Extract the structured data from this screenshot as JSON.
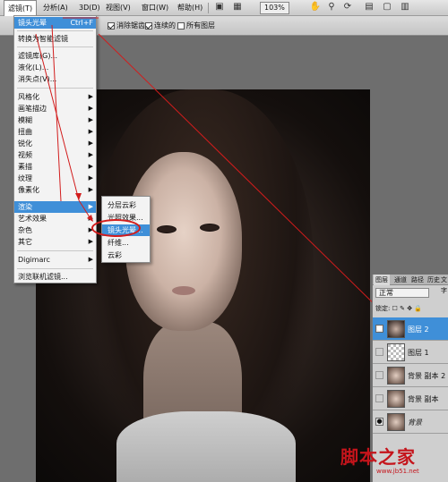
{
  "menubar": {
    "items": [
      "滤镜(T)",
      "分析(A)",
      "3D(D)",
      "视图(V)",
      "窗口(W)",
      "帮助(H)"
    ],
    "zoom": "103%"
  },
  "options": {
    "antialias": "消除锯齿",
    "contiguous": "连续的",
    "all_layers": "所有图层"
  },
  "filter_menu": {
    "items": [
      {
        "label": "镜头光晕",
        "shortcut": "Ctrl+F"
      },
      {
        "label": "转换为智能滤镜"
      },
      {
        "label": "滤镜库(G)..."
      },
      {
        "label": "液化(L)..."
      },
      {
        "label": "消失点(V)..."
      },
      {
        "label": "风格化"
      },
      {
        "label": "画笔描边"
      },
      {
        "label": "模糊"
      },
      {
        "label": "扭曲"
      },
      {
        "label": "锐化"
      },
      {
        "label": "视频"
      },
      {
        "label": "素描"
      },
      {
        "label": "纹理"
      },
      {
        "label": "像素化"
      },
      {
        "label": "渲染"
      },
      {
        "label": "艺术效果"
      },
      {
        "label": "杂色"
      },
      {
        "label": "其它"
      },
      {
        "label": "Digimarc"
      },
      {
        "label": "浏览联机滤镜..."
      }
    ]
  },
  "render_submenu": {
    "items": [
      "分层云彩",
      "光照效果...",
      "镜头光晕...",
      "纤维...",
      "云彩"
    ]
  },
  "layers_panel": {
    "tabs": [
      "图层",
      "通道",
      "路径",
      "历史",
      "文字"
    ],
    "blend_mode": "正常",
    "lock_label": "锁定:",
    "layers": [
      "图层 2",
      "图层 1",
      "背景 副本 2",
      "背景 副本",
      "背景"
    ]
  },
  "watermark": {
    "title": "脚本之家",
    "url": "www.jb51.net"
  },
  "colors": {
    "accent": "#3f8fd8",
    "annotation": "#d21c1c"
  }
}
